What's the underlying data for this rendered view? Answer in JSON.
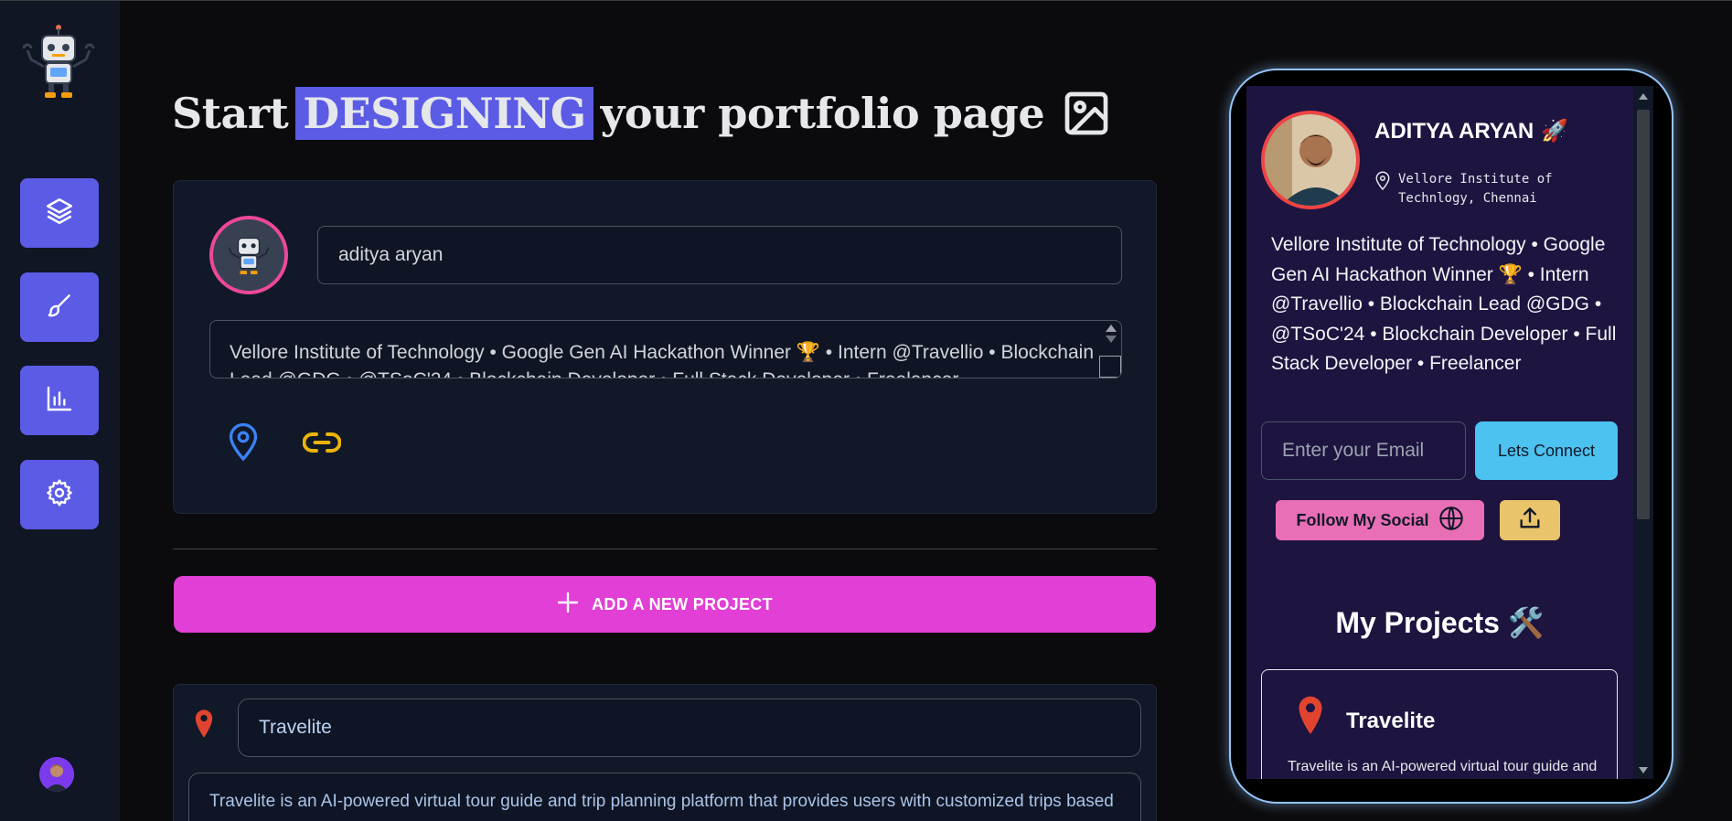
{
  "heading": {
    "start": "Start",
    "highlight": "DESIGNING",
    "rest": "your portfolio page"
  },
  "sidebar": {
    "items": [
      {
        "icon": "layers-icon"
      },
      {
        "icon": "brush-icon"
      },
      {
        "icon": "chart-icon"
      },
      {
        "icon": "gear-icon"
      }
    ]
  },
  "profile": {
    "name_value": "aditya aryan",
    "bio_value": "Vellore Institute of Technology • Google Gen AI Hackathon Winner 🏆 • Intern @Travellio • Blockchain Lead @GDG • @TSoC'24 • Blockchain Developer • Full Stack Developer • Freelancer"
  },
  "actions": {
    "add_project_label": "ADD A NEW PROJECT"
  },
  "project_editor": {
    "title_value": "Travelite",
    "description_value": "Travelite is an AI-powered virtual tour guide and trip planning platform that provides users with customized trips based"
  },
  "preview": {
    "name": "ADITYA ARYAN",
    "name_emoji": "🚀",
    "location": "Vellore Institute of Technlogy, Chennai",
    "bio": "Vellore Institute of Technology • Google Gen AI Hackathon Winner 🏆 • Intern @Travellio • Blockchain Lead @GDG • @TSoC'24 • Blockchain Developer • Full Stack Developer • Freelancer",
    "email_placeholder": "Enter your Email",
    "connect_label": "Lets Connect",
    "follow_label": "Follow My Social",
    "projects_title": "My Projects 🛠️",
    "project": {
      "name": "Travelite",
      "description": "Travelite is an AI-powered virtual tour guide and trip planning platform that provides"
    }
  },
  "colors": {
    "accent": "#5b5be6",
    "add_project": "#e13fd6",
    "connect": "#4cc2f0",
    "follow": "#e86fb6",
    "share": "#e9c46a",
    "pin_blue": "#3b82f6",
    "link_yellow": "#eab308",
    "pin_red": "#ef4444"
  }
}
